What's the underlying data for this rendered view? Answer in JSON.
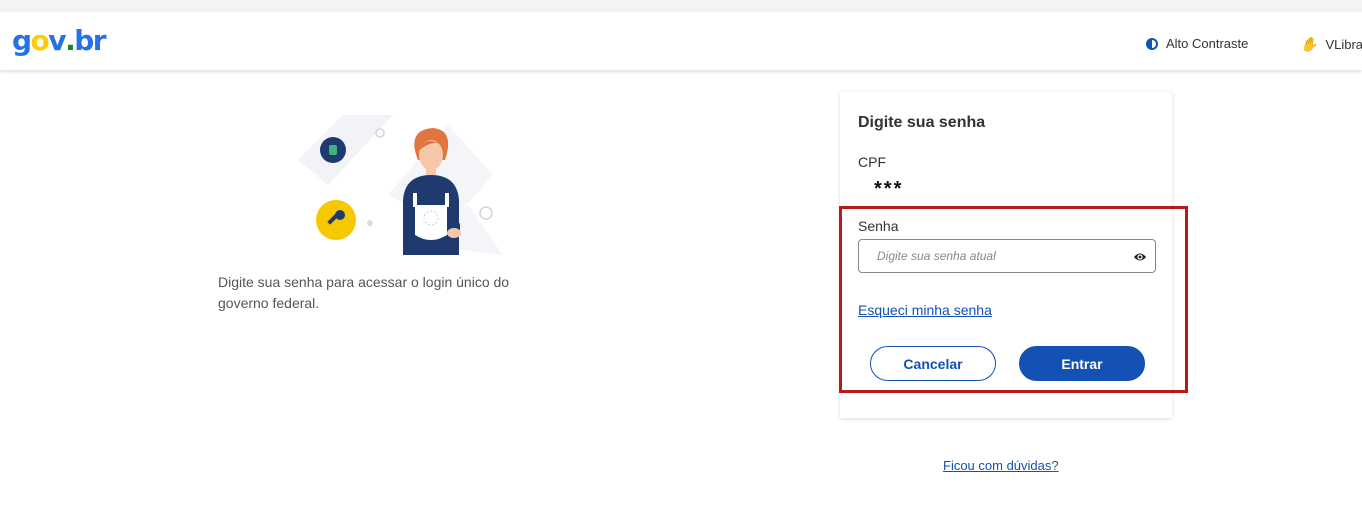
{
  "header": {
    "logo_parts": [
      "g",
      "o",
      "v",
      ".",
      "b",
      "r"
    ],
    "logo_colors": [
      "#2670e8",
      "#ffcd07",
      "#2670e8",
      "#168821",
      "#2670e8",
      "#2670e8"
    ],
    "contrast_label": "Alto Contraste",
    "vlibras_label": "VLibras"
  },
  "left": {
    "description": "Digite sua senha para acessar o login único do governo federal."
  },
  "card": {
    "title": "Digite sua senha",
    "cpf_label": "CPF",
    "cpf_value": "***",
    "password_label": "Senha",
    "password_placeholder": "Digite sua senha atual",
    "forgot_link": "Esqueci minha senha",
    "cancel_button": "Cancelar",
    "submit_button": "Entrar"
  },
  "help_link": "Ficou com dúvidas?",
  "colors": {
    "primary": "#1351b4",
    "highlight_border": "#b81a1a"
  },
  "icons": [
    "contrast-icon",
    "hand-icon",
    "eye-icon",
    "key-icon",
    "lock-icon"
  ]
}
